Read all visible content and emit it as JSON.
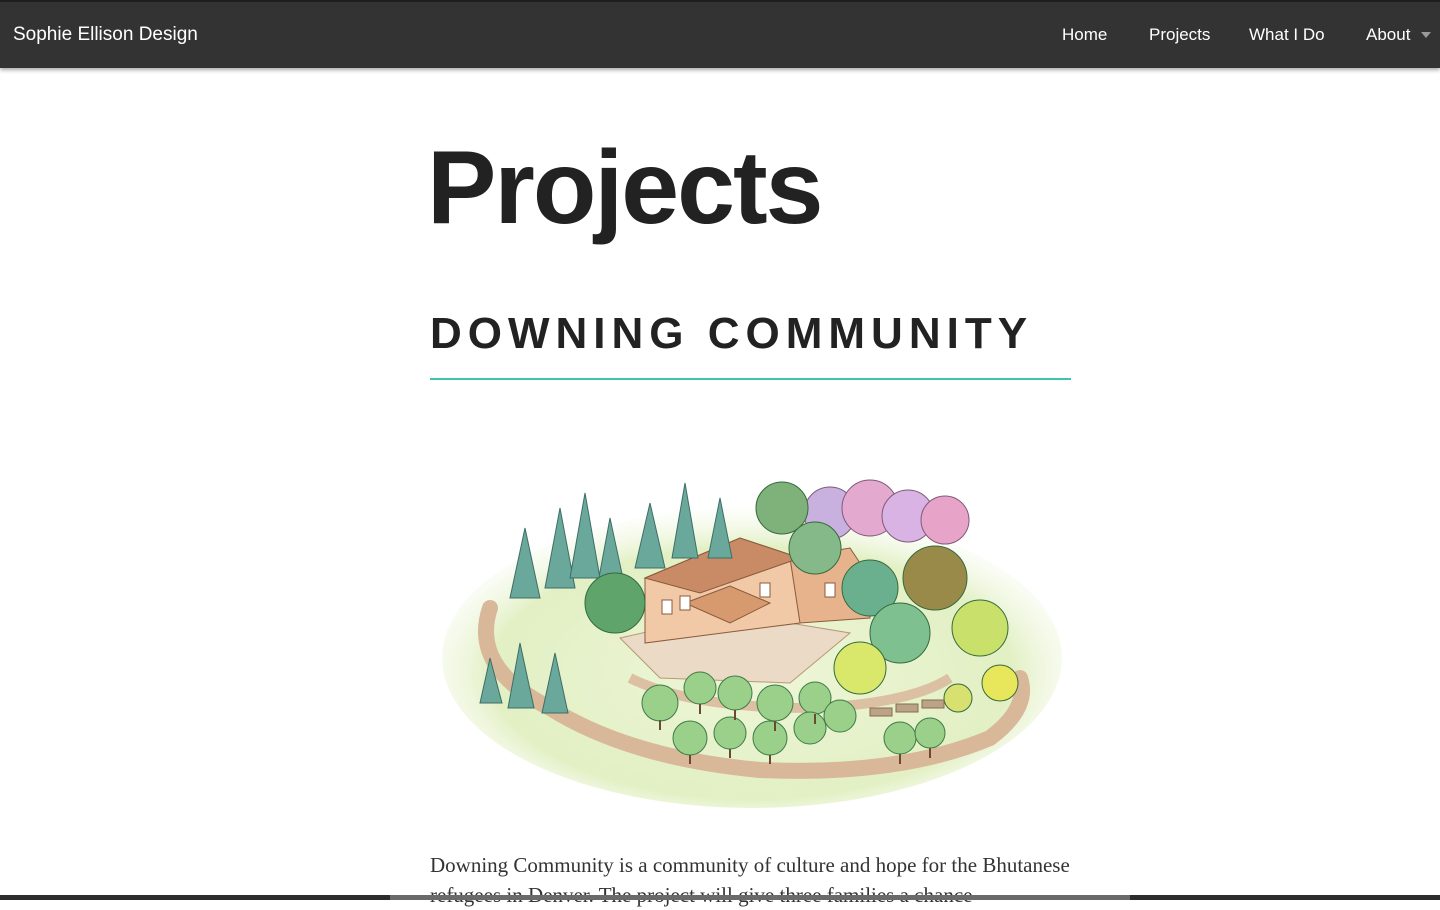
{
  "header": {
    "site_title": "Sophie Ellison Design",
    "nav": [
      {
        "label": "Home"
      },
      {
        "label": "Projects"
      },
      {
        "label": "What I Do"
      },
      {
        "label": "About"
      }
    ]
  },
  "main": {
    "page_title": "Projects",
    "project": {
      "heading": "DOWNING COMMUNITY",
      "description": "Downing Community is a community of culture and hope for the Bhutanese refugees in Denver. The project will give three families a chance"
    }
  },
  "colors": {
    "header_bg": "#333333",
    "accent_rule": "#3cc5ab",
    "heading_text": "#222222"
  },
  "icons": {
    "about_dropdown": "chevron-down-icon"
  }
}
